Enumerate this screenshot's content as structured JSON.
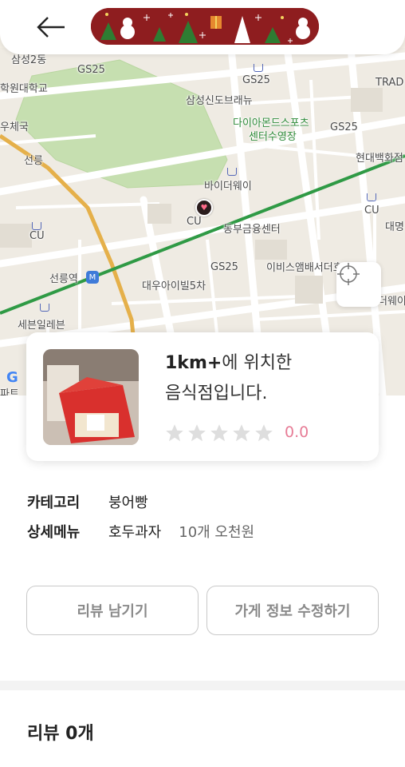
{
  "header": {
    "back_icon": "arrow-left-icon",
    "banner_icon": "christmas-pattern-banner"
  },
  "map": {
    "labels": {
      "l1": "삼성2동",
      "l2": "학원대학교",
      "l3": "GS25",
      "l4": "GS25",
      "l5": "TRAD",
      "l6": "삼성신도브래뉴",
      "l7": "우체국",
      "l8": "다이아몬드스포츠",
      "l9": "센터수영장",
      "l10": "GS25",
      "l11": "선릉",
      "l12": "현대백화점",
      "l13": "바이더웨이",
      "l14": "CU",
      "l15": "CU",
      "l16": "대명",
      "l17": "CU",
      "l18": "동부금융센터",
      "l19": "GS25",
      "l20": "이비스앰배서더호",
      "l21": "선릉역",
      "l22": "대우아이빌5차",
      "l23": "더웨이",
      "l24": "세븐일레븐",
      "l25": "파트",
      "l26": "G"
    },
    "locate_icon": "crosshair-icon",
    "pin_icon": "heart-pin-icon",
    "subway_icon": "subway-icon"
  },
  "store": {
    "distance": "1km+",
    "title_rest": "에 위치한",
    "title_line2": "음식점입니다.",
    "rating": "0.0",
    "star_count": 5,
    "rating_color": "#e77c96"
  },
  "info": {
    "category_label": "카테고리",
    "category_value": "붕어빵",
    "menu_label": "상세메뉴",
    "menu_item": "호두과자",
    "menu_price": "10개 오천원"
  },
  "actions": {
    "review_button": "리뷰 남기기",
    "edit_button": "가게 정보 수정하기"
  },
  "reviews": {
    "heading": "리뷰 0개"
  }
}
